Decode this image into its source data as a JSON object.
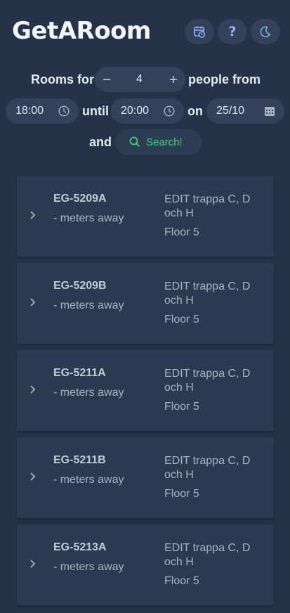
{
  "header": {
    "title": "GetARoom",
    "buttons": [
      {
        "name": "calendar-clock-icon"
      },
      {
        "name": "help-icon",
        "glyph": "?"
      },
      {
        "name": "dark-mode-moon-icon"
      }
    ]
  },
  "search": {
    "rooms_for_label": "Rooms for",
    "people_count": "4",
    "people_from_label": "people from",
    "start_time": "18:00",
    "until_label": "until",
    "end_time": "20:00",
    "on_label": "on",
    "date": "25/10",
    "and_label": "and",
    "search_button_label": "Search!"
  },
  "results": [
    {
      "room": "EG-5209A",
      "distance": "- meters away",
      "building": "EDIT trappa C, D och H",
      "floor": "Floor 5"
    },
    {
      "room": "EG-5209B",
      "distance": "- meters away",
      "building": "EDIT trappa C, D och H",
      "floor": "Floor 5"
    },
    {
      "room": "EG-5211A",
      "distance": "- meters away",
      "building": "EDIT trappa C, D och H",
      "floor": "Floor 5"
    },
    {
      "room": "EG-5211B",
      "distance": "- meters away",
      "building": "EDIT trappa C, D och H",
      "floor": "Floor 5"
    },
    {
      "room": "EG-5213A",
      "distance": "- meters away",
      "building": "EDIT trappa C, D och H",
      "floor": "Floor 5"
    }
  ],
  "colors": {
    "background": "#253248",
    "card": "#2b3a50",
    "pill": "#33425a",
    "accent_green": "#3ed27a",
    "icon_blue": "#8fb4ff"
  }
}
